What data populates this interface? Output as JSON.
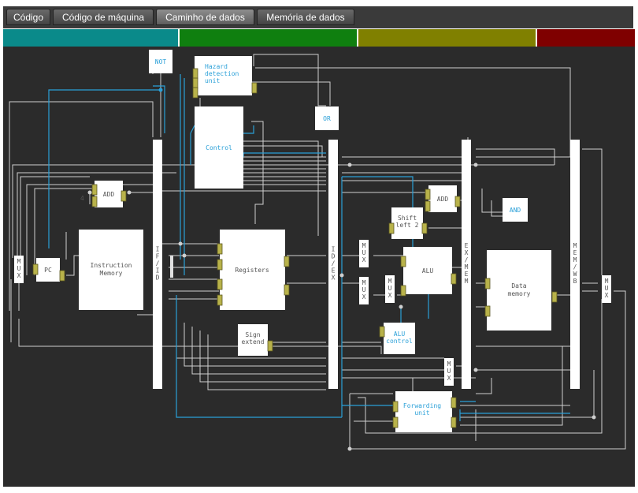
{
  "tabs": [
    {
      "label": "Código"
    },
    {
      "label": "Código de máquina"
    },
    {
      "label": "Caminho de dados",
      "active": true
    },
    {
      "label": "Memória de dados"
    }
  ],
  "stage_colors": [
    "#0a8a8a",
    "#0f7f0f",
    "#808000",
    "#7f0000"
  ],
  "colors": {
    "panel": "#2b2b2b",
    "wire": "#cfcfcf",
    "bus": "#2aa0d8",
    "block": "#ffffff",
    "port": "#b8b24a",
    "active_text": "#2aa0d8",
    "inactive_text": "#555555"
  },
  "units": {
    "not": "NOT",
    "hazard": [
      "Hazard",
      "detection",
      "unit"
    ],
    "control": "Control",
    "or": "OR",
    "add_pc": "ADD",
    "four": "4",
    "pc": "PC",
    "instruction_memory": [
      "Instruction",
      "Memory"
    ],
    "registers": "Registers",
    "sign_extend": [
      "Sign",
      "extend"
    ],
    "add_branch": "ADD",
    "shift_left": [
      "Shift",
      "left 2"
    ],
    "alu": "ALU",
    "alu_control": [
      "ALU",
      "control"
    ],
    "and": "AND",
    "data_memory": [
      "Data",
      "memory"
    ],
    "forwarding": [
      "Forwarding",
      "unit"
    ],
    "mux": [
      "M",
      "U",
      "X"
    ],
    "if_id": [
      "I",
      "F",
      "/",
      "I",
      "D"
    ],
    "id_ex": [
      "I",
      "D",
      "/",
      "E",
      "X"
    ],
    "ex_mem": [
      "E",
      "X",
      "/",
      "M",
      "E",
      "M"
    ],
    "mem_wb": [
      "M",
      "E",
      "M",
      "/",
      "W",
      "B"
    ]
  }
}
